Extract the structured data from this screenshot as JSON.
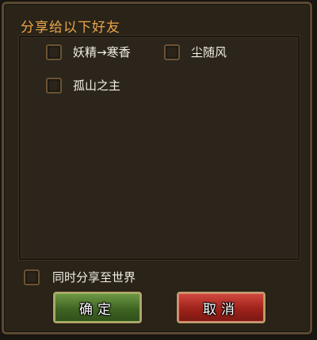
{
  "dialog": {
    "title": "分享给以下好友"
  },
  "friends": [
    {
      "name": "妖精→寒香",
      "checked": false
    },
    {
      "name": "尘随风",
      "checked": false
    },
    {
      "name": "孤山之主",
      "checked": false
    }
  ],
  "share_world": {
    "label": "同时分享至世界",
    "checked": false
  },
  "buttons": {
    "confirm": "确定",
    "cancel": "取消"
  },
  "colors": {
    "title": "#e9a64a",
    "confirm_button": "#4c7a2c",
    "cancel_button": "#b0281f",
    "checkbox_border": "#6b5333"
  }
}
